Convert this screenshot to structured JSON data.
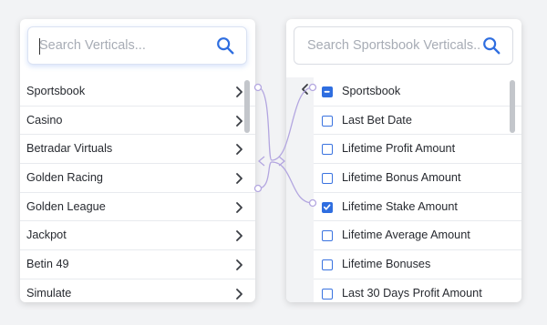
{
  "left": {
    "search": {
      "placeholder": "Search Verticals..."
    },
    "items": [
      {
        "label": "Sportsbook"
      },
      {
        "label": "Casino"
      },
      {
        "label": "Betradar Virtuals"
      },
      {
        "label": "Golden Racing"
      },
      {
        "label": "Golden League"
      },
      {
        "label": "Jackpot"
      },
      {
        "label": "Betin 49"
      },
      {
        "label": "Simulate"
      }
    ]
  },
  "right": {
    "search": {
      "placeholder": "Search Sportsbook Verticals..."
    },
    "items": [
      {
        "label": "Sportsbook",
        "state": "indeterminate"
      },
      {
        "label": "Last Bet Date",
        "state": "unchecked"
      },
      {
        "label": "Lifetime Profit Amount",
        "state": "unchecked"
      },
      {
        "label": "Lifetime Bonus Amount",
        "state": "unchecked"
      },
      {
        "label": "Lifetime Stake Amount",
        "state": "checked"
      },
      {
        "label": "Lifetime Average Amount",
        "state": "unchecked"
      },
      {
        "label": "Lifetime Bonuses",
        "state": "unchecked"
      },
      {
        "label": "Last 30 Days Profit Amount",
        "state": "unchecked"
      }
    ]
  },
  "colors": {
    "accent": "#2f6ee0",
    "connector": "#b3a6e0",
    "background": "#f2f3f5"
  },
  "icons": {
    "search": "search-icon",
    "chevron": "chevron-right-icon",
    "back": "chevron-left-icon"
  }
}
